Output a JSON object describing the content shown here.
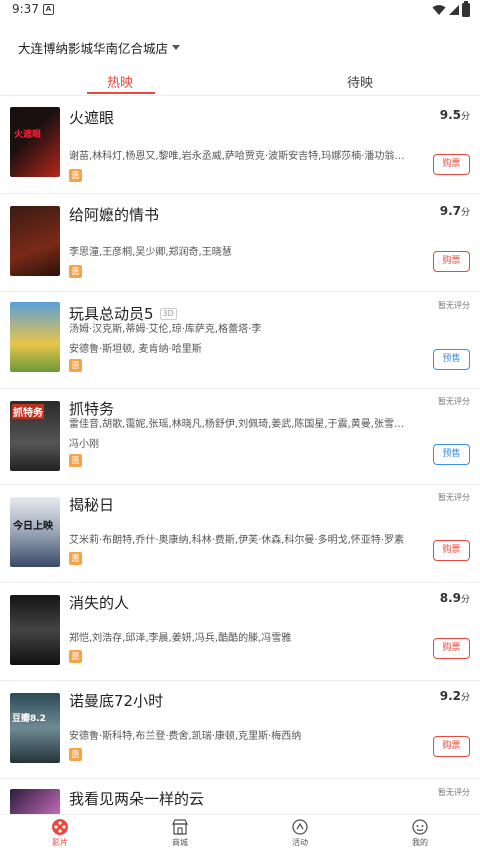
{
  "status": {
    "time": "9:37",
    "notif": "A"
  },
  "header": {
    "cinema_name": "大连博纳影城华南亿合城店"
  },
  "tabs": [
    {
      "label": "热映"
    },
    {
      "label": "待映"
    }
  ],
  "movies": [
    {
      "title": "火遮眼",
      "cast": "谢苗,林科灯,杨恩又,黎唯,岩永丞威,萨哈贾克·波斯安吉特,玛娜莎楠·潘功翁固,郭峻...",
      "cast2": "",
      "score": "9.5",
      "score_unit": "分",
      "button": "购票",
      "hui": "惠",
      "poster_colors": [
        "#1a1010",
        "#b8261c"
      ],
      "poster_text": "火遮眼"
    },
    {
      "title": "给阿嬷的情书",
      "cast": "李思潼,王彦桐,吴少卿,郑润奇,王晓慧",
      "cast2": "",
      "score": "9.7",
      "score_unit": "分",
      "button": "购票",
      "hui": "惠",
      "poster_colors": [
        "#3a1a12",
        "#7a2a18"
      ],
      "poster_text": ""
    },
    {
      "title": "玩具总动员5",
      "badge": "3D",
      "cast": "汤姆·汉克斯,蒂姆·艾伦,琼·库萨克,格蕾塔·李",
      "cast2": "安德鲁·斯坦顿, 麦肯纳·哈里斯",
      "noscore": "暂无评分",
      "button": "预售",
      "hui": "惠",
      "poster_colors": [
        "#5aa0d8",
        "#e9c44a"
      ],
      "poster_text": ""
    },
    {
      "title": "抓特务",
      "cast": "雷佳音,胡歌,霭妮,张瑶,林晓凡,杨舒伊,刘佩琦,姜武,陈国星,于震,黄曼,张雪迎,梁洁,...",
      "cast2": "冯小刚",
      "noscore": "暂无评分",
      "button": "预售",
      "hui": "惠",
      "poster_colors": [
        "#2a2a2a",
        "#c0331f"
      ],
      "poster_text": "抓特务"
    },
    {
      "title": "揭秘日",
      "cast": "艾米莉·布朗特,乔什·奥康纳,科林·费斯,伊芙·休森,科尔曼·多明戈,怀亚特·罗素",
      "cast2": "",
      "noscore": "暂无评分",
      "button": "购票",
      "hui": "惠",
      "poster_colors": [
        "#d9dde3",
        "#3a4a66"
      ],
      "poster_text": "今日上映"
    },
    {
      "title": "消失的人",
      "cast": "郑恺,刘浩存,邱泽,李晨,姜妍,冯兵,酷酷的滕,冯雪雅",
      "cast2": "",
      "score": "8.9",
      "score_unit": "分",
      "button": "购票",
      "hui": "惠",
      "poster_colors": [
        "#141414",
        "#444"
      ],
      "poster_text": ""
    },
    {
      "title": "诺曼底72小时",
      "cast": "安德鲁·斯科特,布兰登·费舍,凯瑞·康顿,克里斯·梅西纳",
      "cast2": "",
      "score": "9.2",
      "score_unit": "分",
      "button": "购票",
      "hui": "惠",
      "poster_colors": [
        "#2d4a58",
        "#6f8a92"
      ],
      "poster_text": "豆瓣8.2"
    },
    {
      "title": "我看见两朵一样的云",
      "cast": "",
      "cast2": "",
      "noscore": "暂无评分",
      "button": "",
      "hui": "",
      "poster_colors": [
        "#2a1c3a",
        "#c46ab8"
      ],
      "poster_text": ""
    }
  ],
  "bottom_nav": [
    {
      "label": "影片",
      "icon": "film-reel-icon"
    },
    {
      "label": "商城",
      "icon": "store-icon"
    },
    {
      "label": "活动",
      "icon": "activity-icon"
    },
    {
      "label": "我的",
      "icon": "profile-icon"
    }
  ],
  "colors": {
    "accent": "#e8493e",
    "presale": "#3b8fe8",
    "discount": "#f5a34a"
  }
}
